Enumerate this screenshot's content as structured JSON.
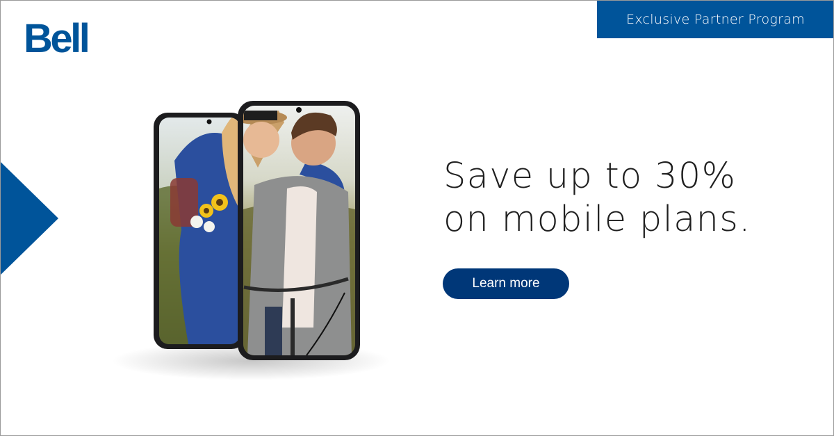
{
  "brand": {
    "name": "Bell"
  },
  "badge": {
    "label": "Exclusive Partner Program"
  },
  "headline": {
    "line1": "Save up to 30%",
    "line2": "on mobile plans."
  },
  "cta": {
    "label": "Learn more"
  },
  "colors": {
    "brand_blue": "#00549a",
    "badge_blue": "#00549a",
    "cta_navy": "#003778",
    "text_dark": "#1f1f1f"
  },
  "icons": {
    "arrow": "triangle-right-icon"
  }
}
